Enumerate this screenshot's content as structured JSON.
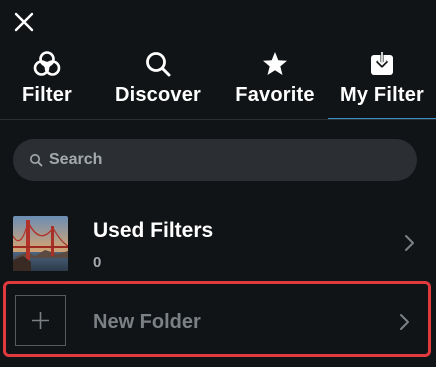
{
  "header": {
    "close_icon": "close-icon"
  },
  "tabs": [
    {
      "label": "Filter",
      "icon": "filter-icon",
      "active": false
    },
    {
      "label": "Discover",
      "icon": "search-icon",
      "active": false
    },
    {
      "label": "Favorite",
      "icon": "star-icon",
      "active": false
    },
    {
      "label": "My Filter",
      "icon": "download-box-icon",
      "active": true
    }
  ],
  "search": {
    "placeholder": "Search"
  },
  "rows": {
    "used_filters": {
      "title": "Used Filters",
      "count": "0"
    },
    "new_folder": {
      "title": "New Folder"
    }
  },
  "colors": {
    "background": "#111416",
    "accent": "#3b8fc9",
    "highlight_border": "#e03a3e",
    "muted_text": "#a4a9ad"
  }
}
